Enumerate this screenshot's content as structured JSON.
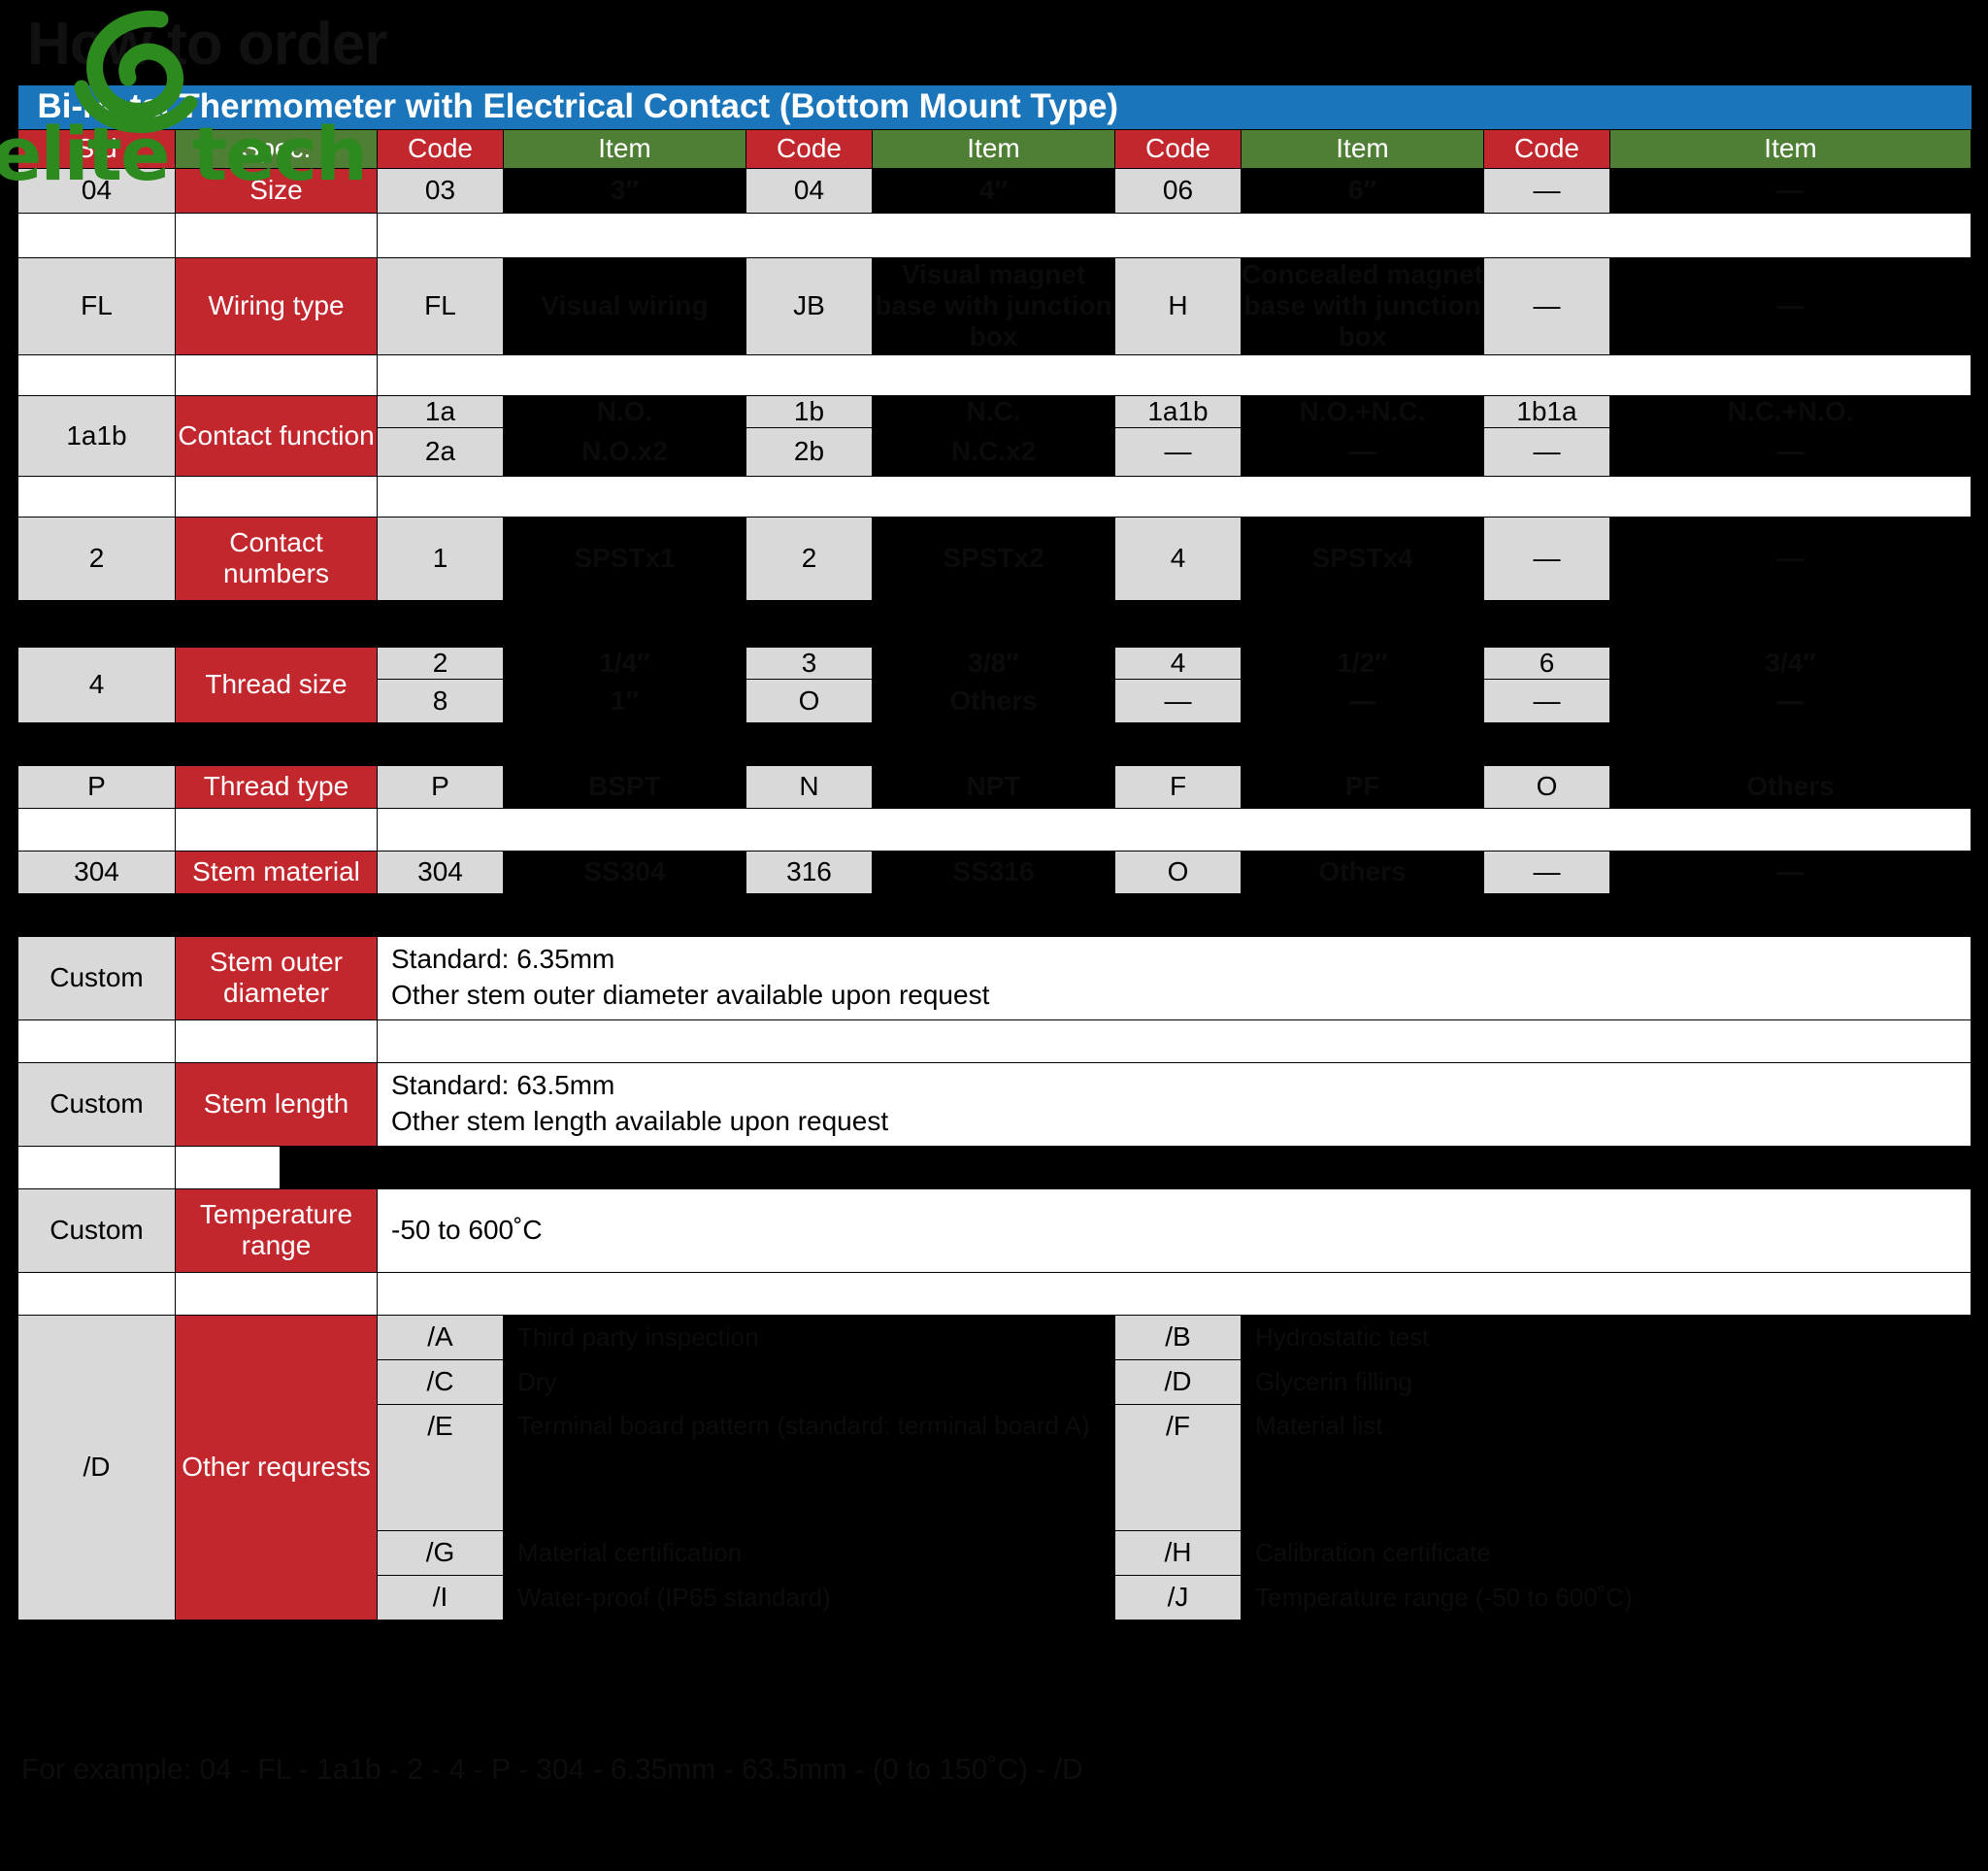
{
  "page": {
    "heading": "How to order",
    "background_color": "#000000",
    "watermark_text": "elite tech",
    "watermark_color": "#2d8a1e"
  },
  "title_bar": {
    "text": "Bi-Metal Thermometer with Electrical Contact (Bottom Mount Type)",
    "background_color": "#1b75bb",
    "text_color": "#ffffff"
  },
  "colors": {
    "code_header": "#c1272d",
    "item_header": "#4e7f35",
    "spec_cell": "#c1272d",
    "code_cell": "#d9d9d9",
    "item_cell": "#000000"
  },
  "header": {
    "std": "Std",
    "spec": "Spec.",
    "code1": "Code",
    "item1": "Item",
    "code2": "Code",
    "item2": "Item",
    "code3": "Code",
    "item3": "Item",
    "code4": "Code",
    "item4": "Item"
  },
  "rows": [
    {
      "std": "04",
      "spec": "Size",
      "lines": [
        {
          "code1": "03",
          "item1": "3″",
          "code2": "04",
          "item2": "4″",
          "code3": "06",
          "item3": "6″",
          "code4": "—",
          "item4": "—"
        }
      ]
    },
    {
      "std": "FL",
      "spec": "Wiring type",
      "lines": [
        {
          "code1": "FL",
          "item1": "Visual wiring",
          "code2": "JB",
          "item2": "Visual magnet base with junction box",
          "code3": "H",
          "item3": "Concealed magnet base with junction box",
          "code4": "—",
          "item4": "—"
        }
      ]
    },
    {
      "std": "1a1b",
      "spec": "Contact function",
      "lines": [
        {
          "code1": "1a",
          "item1": "N.O.",
          "code2": "1b",
          "item2": "N.C.",
          "code3": "1a1b",
          "item3": "N.O.+N.C.",
          "code4": "1b1a",
          "item4": "N.C.+N.O."
        },
        {
          "code1": "2a",
          "item1": "N.O.x2",
          "code2": "2b",
          "item2": "N.C.x2",
          "code3": "—",
          "item3": "—",
          "code4": "—",
          "item4": "—"
        }
      ]
    },
    {
      "std": "2",
      "spec": "Contact numbers",
      "lines": [
        {
          "code1": "1",
          "item1": "SPSTx1",
          "code2": "2",
          "item2": "SPSTx2",
          "code3": "4",
          "item3": "SPSTx4",
          "code4": "—",
          "item4": "—"
        }
      ]
    },
    {
      "std": "4",
      "spec": "Thread size",
      "lines": [
        {
          "code1": "2",
          "item1": "1/4″",
          "code2": "3",
          "item2": "3/8″",
          "code3": "4",
          "item3": "1/2″",
          "code4": "6",
          "item4": "3/4″"
        },
        {
          "code1": "8",
          "item1": "1″",
          "code2": "O",
          "item2": "Others",
          "code3": "—",
          "item3": "—",
          "code4": "—",
          "item4": "—"
        }
      ]
    },
    {
      "std": "P",
      "spec": "Thread type",
      "lines": [
        {
          "code1": "P",
          "item1": "BSPT",
          "code2": "N",
          "item2": "NPT",
          "code3": "F",
          "item3": "PF",
          "code4": "O",
          "item4": "Others"
        }
      ]
    },
    {
      "std": "304",
      "spec": "Stem material",
      "lines": [
        {
          "code1": "304",
          "item1": "SS304",
          "code2": "316",
          "item2": "SS316",
          "code3": "O",
          "item3": "Others",
          "code4": "—",
          "item4": "—"
        }
      ]
    }
  ],
  "custom_rows": [
    {
      "std": "Custom",
      "spec": "Stem outer diameter",
      "line1": "Standard: 6.35mm",
      "line2": "Other stem outer diameter available upon request"
    },
    {
      "std": "Custom",
      "spec": "Stem length",
      "line1": "Standard: 63.5mm",
      "line2": "Other stem length available upon request"
    },
    {
      "std": "Custom",
      "spec": "Temperature range",
      "line1": "-50 to 600˚C",
      "line2": ""
    }
  ],
  "other_requests": {
    "std": "/D",
    "spec": "Other requrests",
    "entries": [
      {
        "code_left": "/A",
        "item_left": "Third party inspection",
        "code_right": "/B",
        "item_right": "Hydrostatic test"
      },
      {
        "code_left": "/C",
        "item_left": "Dry",
        "code_right": "/D",
        "item_right": "Glycerin filling"
      },
      {
        "code_left": "/E",
        "item_left": "Terminal board pattern (standard: terminal board A)",
        "code_right": "/F",
        "item_right": "Material list"
      },
      {
        "code_left": "/G",
        "item_left": "Material certification",
        "code_right": "/H",
        "item_right": "Calibration certificate"
      },
      {
        "code_left": "/I",
        "item_left": "Water-proof (IP65 standard)",
        "code_right": "/J",
        "item_right": "Temperature range (-50 to 600˚C)"
      }
    ]
  },
  "footnote": {
    "text": "For example: 04 - FL - 1a1b - 2 - 4 - P - 304 - 6.35mm - 63.5mm - (0 to 150˚C) - /D"
  }
}
